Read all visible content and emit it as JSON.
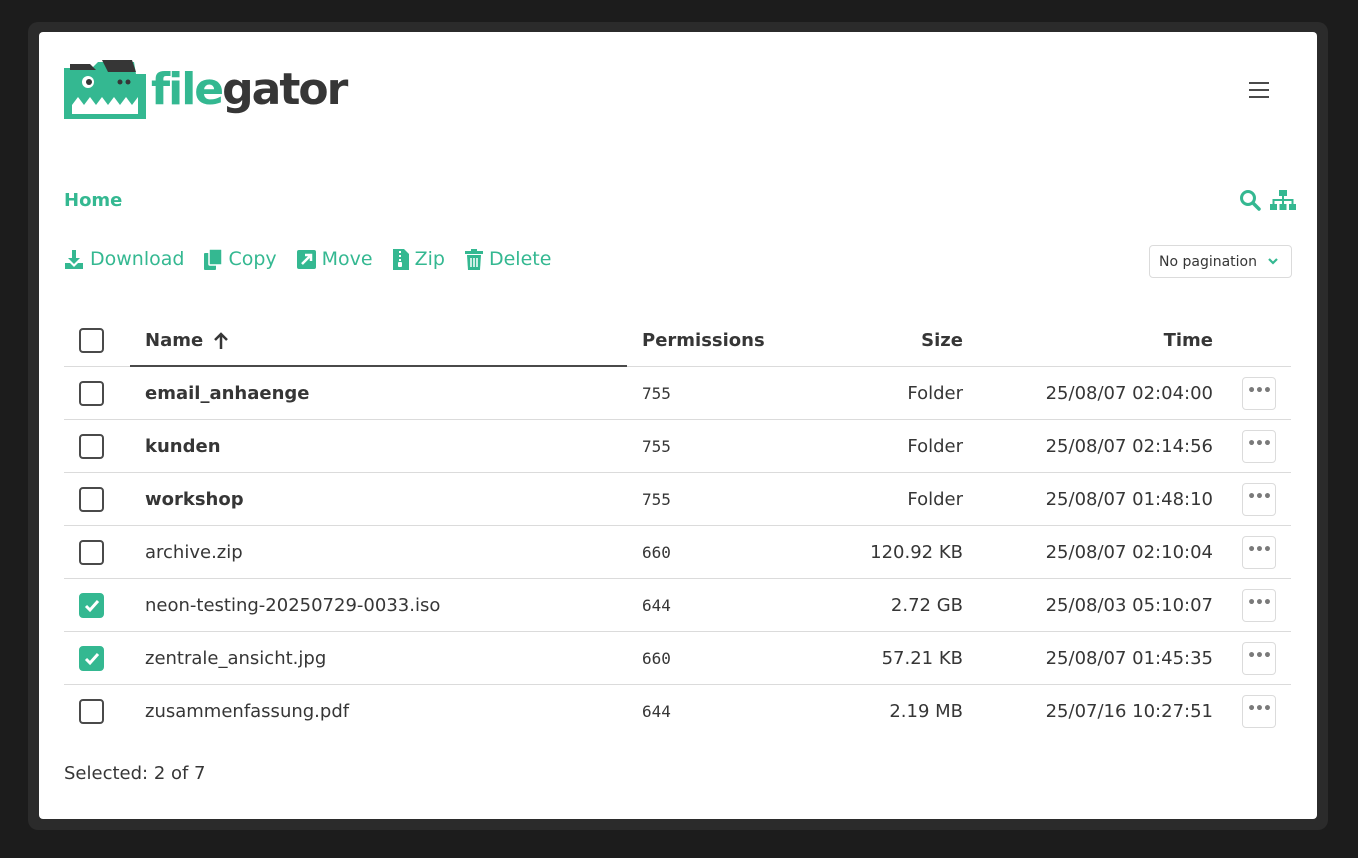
{
  "app": {
    "logo_file": "file",
    "logo_gator": "gator"
  },
  "breadcrumb": {
    "home": "Home"
  },
  "toolbar": [
    {
      "key": "download",
      "label": "Download",
      "icon": "download-icon"
    },
    {
      "key": "copy",
      "label": "Copy",
      "icon": "copy-icon"
    },
    {
      "key": "move",
      "label": "Move",
      "icon": "move-icon"
    },
    {
      "key": "zip",
      "label": "Zip",
      "icon": "zip-icon"
    },
    {
      "key": "delete",
      "label": "Delete",
      "icon": "trash-icon"
    }
  ],
  "pagination": {
    "selected": "No pagination"
  },
  "table": {
    "headers": {
      "name": "Name",
      "permissions": "Permissions",
      "size": "Size",
      "time": "Time"
    },
    "sort": {
      "column": "name",
      "direction": "asc"
    },
    "rows": [
      {
        "name": "email_anhaenge",
        "permissions": "755",
        "size": "Folder",
        "time": "25/08/07 02:04:00",
        "folder": true,
        "checked": false
      },
      {
        "name": "kunden",
        "permissions": "755",
        "size": "Folder",
        "time": "25/08/07 02:14:56",
        "folder": true,
        "checked": false
      },
      {
        "name": "workshop",
        "permissions": "755",
        "size": "Folder",
        "time": "25/08/07 01:48:10",
        "folder": true,
        "checked": false
      },
      {
        "name": "archive.zip",
        "permissions": "660",
        "size": "120.92 KB",
        "time": "25/08/07 02:10:04",
        "folder": false,
        "checked": false
      },
      {
        "name": "neon-testing-20250729-0033.iso",
        "permissions": "644",
        "size": "2.72 GB",
        "time": "25/08/03 05:10:07",
        "folder": false,
        "checked": true
      },
      {
        "name": "zentrale_ansicht.jpg",
        "permissions": "660",
        "size": "57.21 KB",
        "time": "25/08/07 01:45:35",
        "folder": false,
        "checked": true
      },
      {
        "name": "zusammenfassung.pdf",
        "permissions": "644",
        "size": "2.19 MB",
        "time": "25/07/16 10:27:51",
        "folder": false,
        "checked": false
      }
    ]
  },
  "footer": {
    "selected_text": "Selected: 2 of 7"
  },
  "colors": {
    "accent": "#34b891",
    "text": "#363636",
    "border": "#dbdbdb"
  }
}
